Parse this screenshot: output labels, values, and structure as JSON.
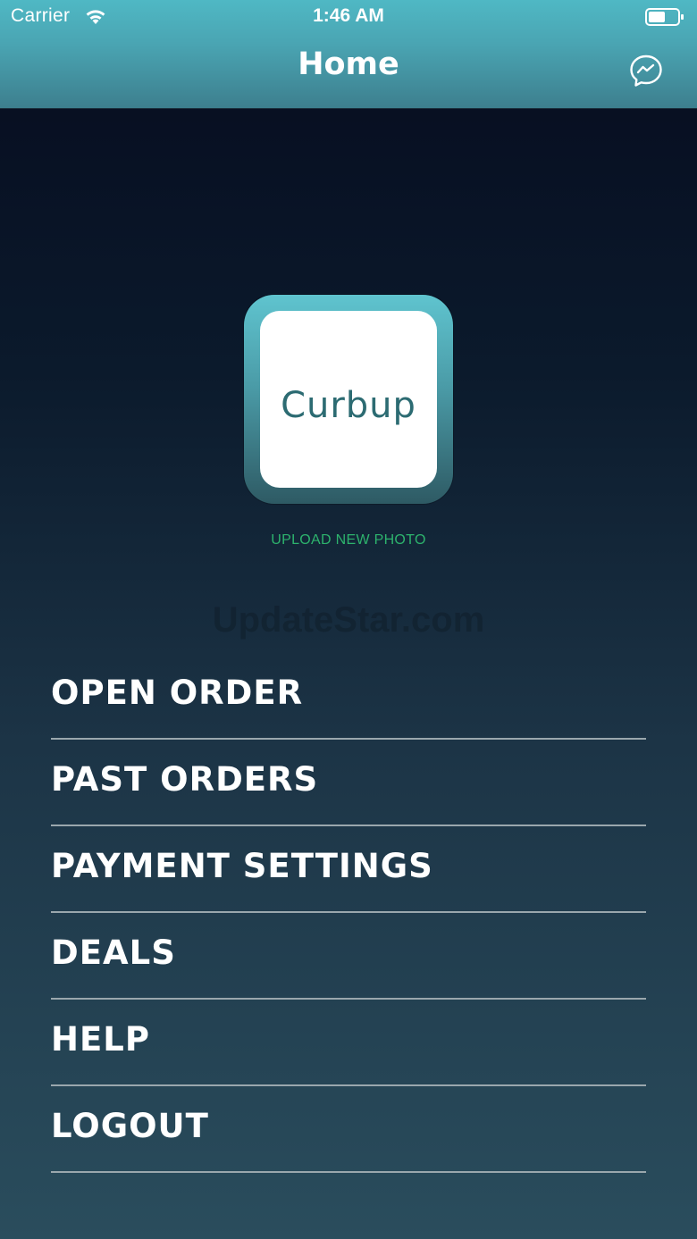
{
  "status_bar": {
    "carrier": "Carrier",
    "time": "1:46 AM"
  },
  "nav": {
    "title": "Home",
    "chat_icon": "messenger-icon"
  },
  "profile": {
    "logo_text": "Curbup",
    "upload_label": "UPLOAD NEW PHOTO"
  },
  "watermark": "UpdateStar.com",
  "menu": {
    "items": [
      {
        "label": "OPEN ORDER"
      },
      {
        "label": "PAST ORDERS"
      },
      {
        "label": "PAYMENT SETTINGS"
      },
      {
        "label": "DEALS"
      },
      {
        "label": "HELP"
      },
      {
        "label": "LOGOUT"
      }
    ]
  },
  "colors": {
    "accent": "#4fb8c4",
    "link_green": "#2db36d",
    "logo": "#2c6b72"
  }
}
